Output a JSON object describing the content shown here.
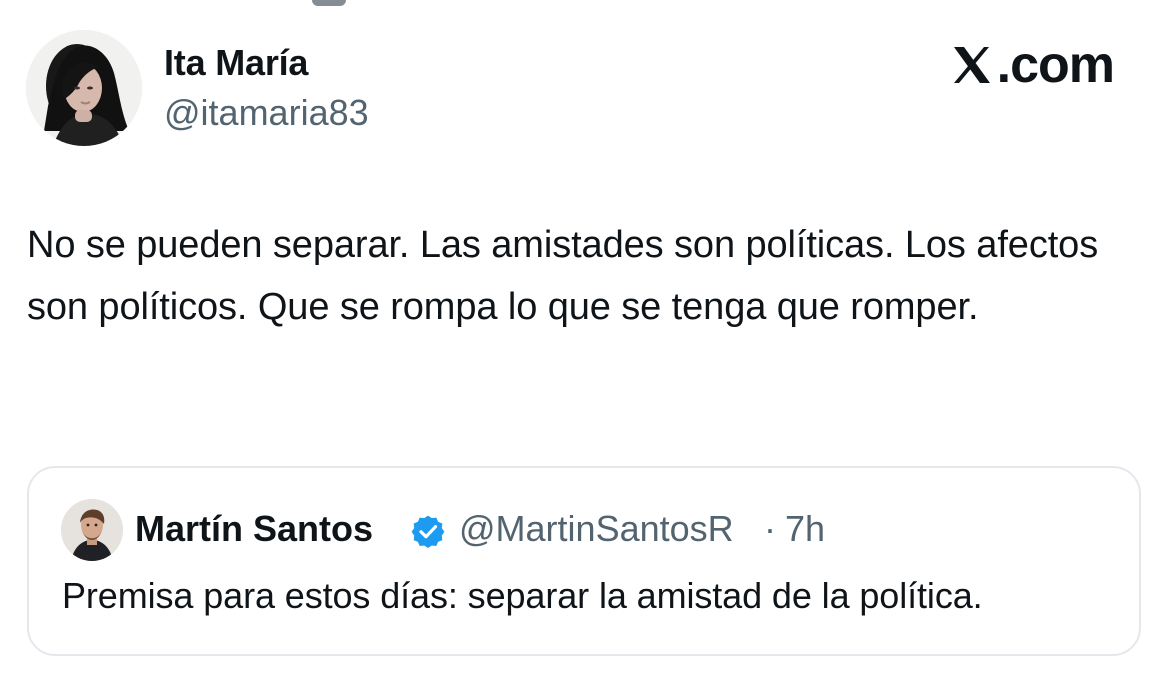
{
  "tweet": {
    "author": {
      "display_name": "Ita María",
      "handle": "@itamaria83",
      "avatar_icon": "profile-photo"
    },
    "brand": {
      "text": ".com",
      "icon": "x-logo-icon"
    },
    "text": "No se pueden separar. Las amistades son políticas. Los afectos son políticos. Que se rompa lo que se tenga que romper.",
    "quoted_tweet": {
      "author_name": "Martín Santos",
      "handle": "@MartinSantosR",
      "separator": "·",
      "time": "7h",
      "verified": true,
      "verified_icon": "verified-badge-icon",
      "verified_color": "#1d9bf0",
      "text": "Premisa para estos días: separar la amistad de la política."
    }
  },
  "colors": {
    "text_primary": "#0f1419",
    "text_secondary": "#536471",
    "border": "#e4e8ec",
    "background": "#ffffff"
  }
}
